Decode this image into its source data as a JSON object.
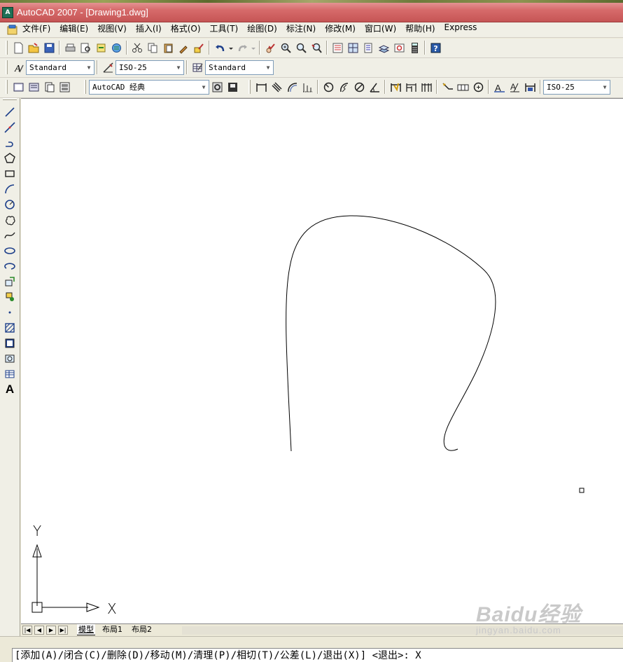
{
  "window": {
    "title": "AutoCAD 2007 - [Drawing1.dwg]"
  },
  "menu": {
    "items": [
      "文件(F)",
      "编辑(E)",
      "视图(V)",
      "插入(I)",
      "格式(O)",
      "工具(T)",
      "绘图(D)",
      "标注(N)",
      "修改(M)",
      "窗口(W)",
      "帮助(H)",
      "Express"
    ]
  },
  "styles_toolbar": {
    "text_style": "Standard",
    "dim_style": "ISO-25",
    "table_style": "Standard"
  },
  "workspace_toolbar": {
    "workspace": "AutoCAD 经典",
    "dim_style": "ISO-25"
  },
  "draw_toolbar": {
    "text_tool_label": "A"
  },
  "ucs": {
    "y_label": "Y",
    "x_label": "X"
  },
  "layout_tabs": [
    "模型",
    "布局1",
    "布局2"
  ],
  "command_line": {
    "prompt": "[添加(A)/闭合(C)/删除(D)/移动(M)/清理(P)/相切(T)/公差(L)/退出(X)] <退出>: X"
  },
  "watermark": {
    "logo": "Baidu经验",
    "url": "jingyan.baidu.com"
  },
  "colors": {
    "title_bar": "#d76b6b",
    "canvas": "#ffffff",
    "chrome": "#ece9d8"
  }
}
